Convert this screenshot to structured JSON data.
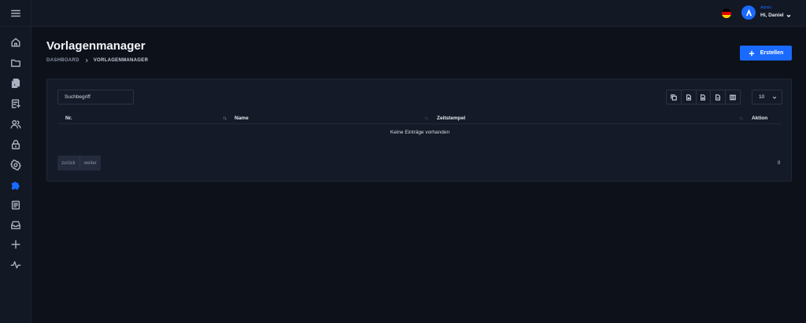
{
  "sidebar": {
    "icons": [
      "menu-icon",
      "home-icon",
      "folder-icon",
      "documents-icon",
      "edit-list-icon",
      "users-icon",
      "lock-icon",
      "settings-icon",
      "puzzle-icon",
      "report-icon",
      "inbox-icon",
      "plus-icon",
      "activity-icon"
    ],
    "active": "puzzle-icon",
    "accent": "#1a6aff"
  },
  "topbar": {
    "language_flag": "de",
    "user_role": "Admin",
    "user_greeting": "Hi, Daniel"
  },
  "page": {
    "title": "Vorlagenmanager",
    "breadcrumb": [
      "DASHBOARD",
      "VORLAGENMANAGER"
    ],
    "create_label": "Erstellen"
  },
  "table": {
    "search_placeholder": "Suchbegriff",
    "export_icons": [
      "copy-icon",
      "csv-icon",
      "excel-icon",
      "pdf-icon",
      "columns-icon"
    ],
    "page_size": "10",
    "columns": [
      "Nr.",
      "Name",
      "Zeitstempel",
      "Aktion"
    ],
    "empty_message": "Keine Einträge vorhanden",
    "pager": {
      "prev": "zurück",
      "next": "weiter"
    },
    "total": "0"
  }
}
